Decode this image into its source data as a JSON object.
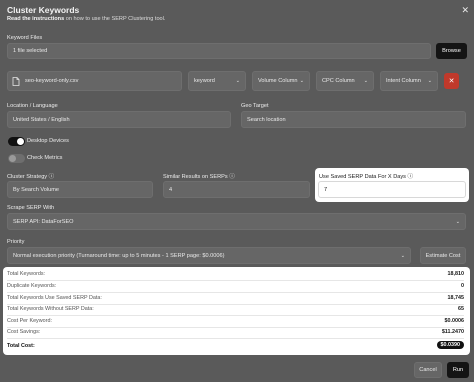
{
  "header": {
    "title": "Cluster Keywords",
    "subtitle_prefix": "Read the instructions",
    "subtitle_suffix": " on how to use the SERP Clustering tool.",
    "close_glyph": "✕"
  },
  "keyword_files": {
    "label": "Keyword Files",
    "file_input_value": "1 file selected",
    "browse_label": "Browse",
    "file_row": {
      "file_name": "seo-keyword-only.csv",
      "keyword_select": "keyword",
      "volume_select": "Volume Column",
      "cpc_select": "CPC Column",
      "intent_select": "Intent Column"
    }
  },
  "location": {
    "label": "Location / Language",
    "value": "United States / English",
    "geo_label": "Geo Target",
    "geo_placeholder": "Search location"
  },
  "toggles": {
    "desktop_label": "Desktop Devices",
    "desktop_on": true,
    "check_metrics_label": "Check Metrics",
    "check_metrics_on": false
  },
  "cluster": {
    "strategy_label": "Cluster Strategy",
    "strategy_value": "By Search Volume",
    "similar_label": "Similar Results on SERPs",
    "similar_value": "4",
    "saved_label": "Use Saved SERP Data For X Days",
    "saved_value": "7"
  },
  "scrape": {
    "label": "Scrape SERP With",
    "value": "SERP API: DataForSEO"
  },
  "priority": {
    "label": "Priority",
    "value": "Normal execution priority (Turnaround time: up to 5 minutes - 1 SERP page: $0.0006)",
    "estimate_label": "Estimate Cost"
  },
  "summary": {
    "total_keywords_label": "Total Keywords:",
    "total_keywords": "18,810",
    "duplicate_label": "Duplicate Keywords:",
    "duplicate": "0",
    "saved_serp_label": "Total Keywords Use Saved SERP Data:",
    "saved_serp": "18,745",
    "without_serp_label": "Total Keywords Without SERP Data:",
    "without_serp": "65",
    "cost_per_label": "Cost Per Keyword:",
    "cost_per": "$0.0006",
    "savings_label": "Cost Savings:",
    "savings": "$11.2470",
    "total_cost_label": "Total Cost:",
    "total_cost": "$0.0390"
  },
  "footer": {
    "cancel_label": "Cancel",
    "run_label": "Run"
  },
  "colors": {
    "overlay": "#5a5a5a",
    "delete_button": "#c0392b",
    "toggle_on": "#111111"
  }
}
